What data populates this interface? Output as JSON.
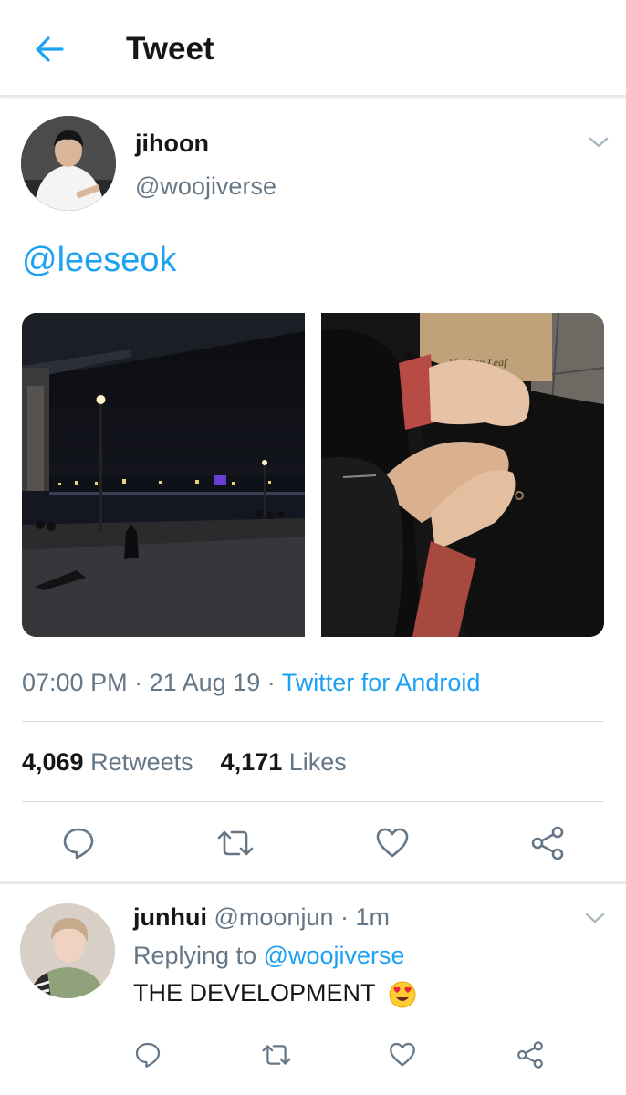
{
  "header": {
    "title": "Tweet",
    "back_icon": "arrow-left-icon"
  },
  "tweet": {
    "author": {
      "name": "jihoon",
      "handle": "@woojiverse"
    },
    "text": "@leeseok",
    "media": [
      {
        "description": "night river scene under bridge"
      },
      {
        "description": "holding hands, paper bag"
      }
    ],
    "bag_text": "Viridian Leaf",
    "time": "07:00 PM",
    "date": "21 Aug 19",
    "separator": "·",
    "source": "Twitter for Android",
    "retweets_count": "4,069",
    "retweets_label": "Retweets",
    "likes_count": "4,171",
    "likes_label": "Likes"
  },
  "reply": {
    "name": "junhui",
    "handle": "@moonjun",
    "separator": "·",
    "time": "1m",
    "replying_prefix": "Replying to",
    "replying_to": "@woojiverse",
    "text": "THE DEVELOPMENT",
    "emoji": "heart-eyes-emoji"
  },
  "colors": {
    "accent": "#1da1f2",
    "muted": "#657786",
    "text": "#14171a",
    "divider": "#e1e8ed"
  }
}
